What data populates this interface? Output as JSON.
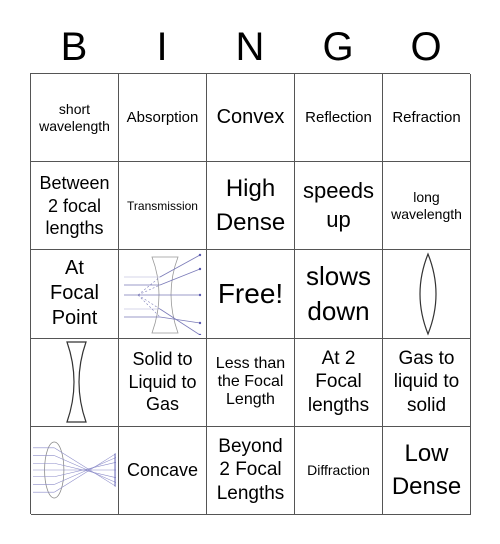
{
  "header": {
    "letters": [
      "B",
      "I",
      "N",
      "G",
      "O"
    ]
  },
  "cells": [
    {
      "type": "text",
      "text": "short\nwavelength"
    },
    {
      "type": "text",
      "text": "Absorption"
    },
    {
      "type": "text",
      "text": "Convex"
    },
    {
      "type": "text",
      "text": "Reflection"
    },
    {
      "type": "text",
      "text": "Refraction"
    },
    {
      "type": "text",
      "text": "Between\n2 focal\nlengths"
    },
    {
      "type": "text",
      "text": "Transmission"
    },
    {
      "type": "text",
      "text": "High\nDense"
    },
    {
      "type": "text",
      "text": "speeds\nup"
    },
    {
      "type": "text",
      "text": "long\nwavelength"
    },
    {
      "type": "text",
      "text": "At\nFocal\nPoint"
    },
    {
      "type": "image",
      "icon": "concave-lens-ray-diagram-icon"
    },
    {
      "type": "free",
      "text": "Free!"
    },
    {
      "type": "text",
      "text": "slows\ndown"
    },
    {
      "type": "image",
      "icon": "convex-lens-icon"
    },
    {
      "type": "image",
      "icon": "concave-lens-icon"
    },
    {
      "type": "text",
      "text": "Solid to\nLiquid to\nGas"
    },
    {
      "type": "text",
      "text": "Less than\nthe Focal\nLength"
    },
    {
      "type": "text",
      "text": "At 2\nFocal\nlengths"
    },
    {
      "type": "text",
      "text": "Gas to\nliquid to\nsolid"
    },
    {
      "type": "image",
      "icon": "convex-lens-converging-rays-icon"
    },
    {
      "type": "text",
      "text": "Concave"
    },
    {
      "type": "text",
      "text": "Beyond\n2 Focal\nLengths"
    },
    {
      "type": "text",
      "text": "Diffraction"
    },
    {
      "type": "text",
      "text": "Low\nDense"
    }
  ],
  "colors": {
    "grid_line": "#555555",
    "ray": "#5a5ab0",
    "lens": "#333333"
  }
}
